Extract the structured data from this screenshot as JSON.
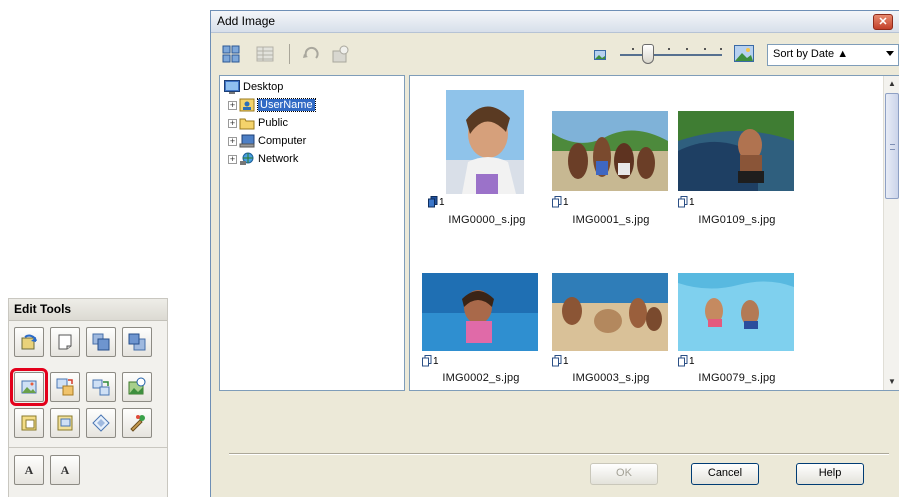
{
  "edit_tools": {
    "title": "Edit Tools",
    "buttons": [
      "rotate-icon",
      "crop-icon",
      "bring-forward-icon",
      "send-backward-icon",
      "add-image-icon",
      "replace-image-icon",
      "swap-images-icon",
      "image-correction-icon",
      "frame-icon",
      "background-icon",
      "layout-shape-icon",
      "paint-icon"
    ],
    "text_buttons": [
      "A",
      "A"
    ],
    "highlight_color": "#e3001b"
  },
  "dialog": {
    "title": "Add Image",
    "close_label": "✕",
    "sort": {
      "selected": "Sort by Date ▲"
    },
    "tree": [
      {
        "label": "Desktop"
      },
      {
        "label": "UserName",
        "selected": true
      },
      {
        "label": "Public"
      },
      {
        "label": "Computer"
      },
      {
        "label": "Network"
      }
    ],
    "thumbnails": [
      {
        "filename": "IMG0000_s.jpg",
        "count": "1"
      },
      {
        "filename": "IMG0001_s.jpg",
        "count": "1"
      },
      {
        "filename": "IMG0109_s.jpg",
        "count": "1"
      },
      {
        "filename": "IMG0002_s.jpg",
        "count": "1"
      },
      {
        "filename": "IMG0003_s.jpg",
        "count": "1"
      },
      {
        "filename": "IMG0079_s.jpg",
        "count": "1"
      }
    ],
    "buttons": {
      "ok": "OK",
      "cancel": "Cancel",
      "help": "Help"
    },
    "accent_color": "#316ac5"
  }
}
